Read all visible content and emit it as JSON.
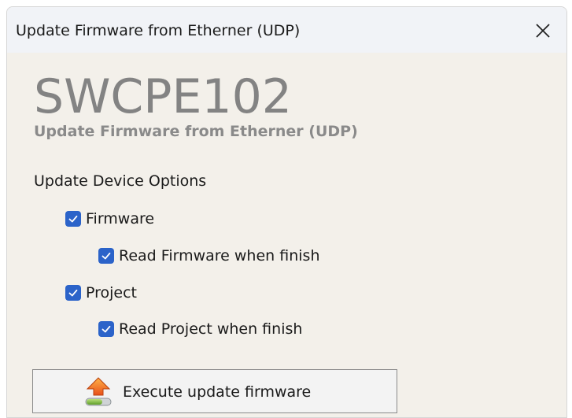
{
  "window": {
    "title": "Update Firmware from Etherner (UDP)"
  },
  "header": {
    "device_name": "SWCPE102",
    "subtitle": "Update Firmware from Etherner (UDP)"
  },
  "options": {
    "section_label": "Update Device Options",
    "items": [
      {
        "label": "Firmware",
        "checked": true
      },
      {
        "label": "Read Firmware when finish",
        "checked": true
      },
      {
        "label": "Project",
        "checked": true
      },
      {
        "label": "Read Project when finish",
        "checked": true
      }
    ]
  },
  "actions": {
    "execute_label": "Execute update firmware"
  },
  "icons": {
    "close": "close-icon",
    "checkbox": "checkmark-icon",
    "execute": "upload-arrow-icon"
  },
  "colors": {
    "checkbox_accent": "#2b63c9",
    "big_title": "#838383",
    "window_bg": "#f3f0ea"
  }
}
